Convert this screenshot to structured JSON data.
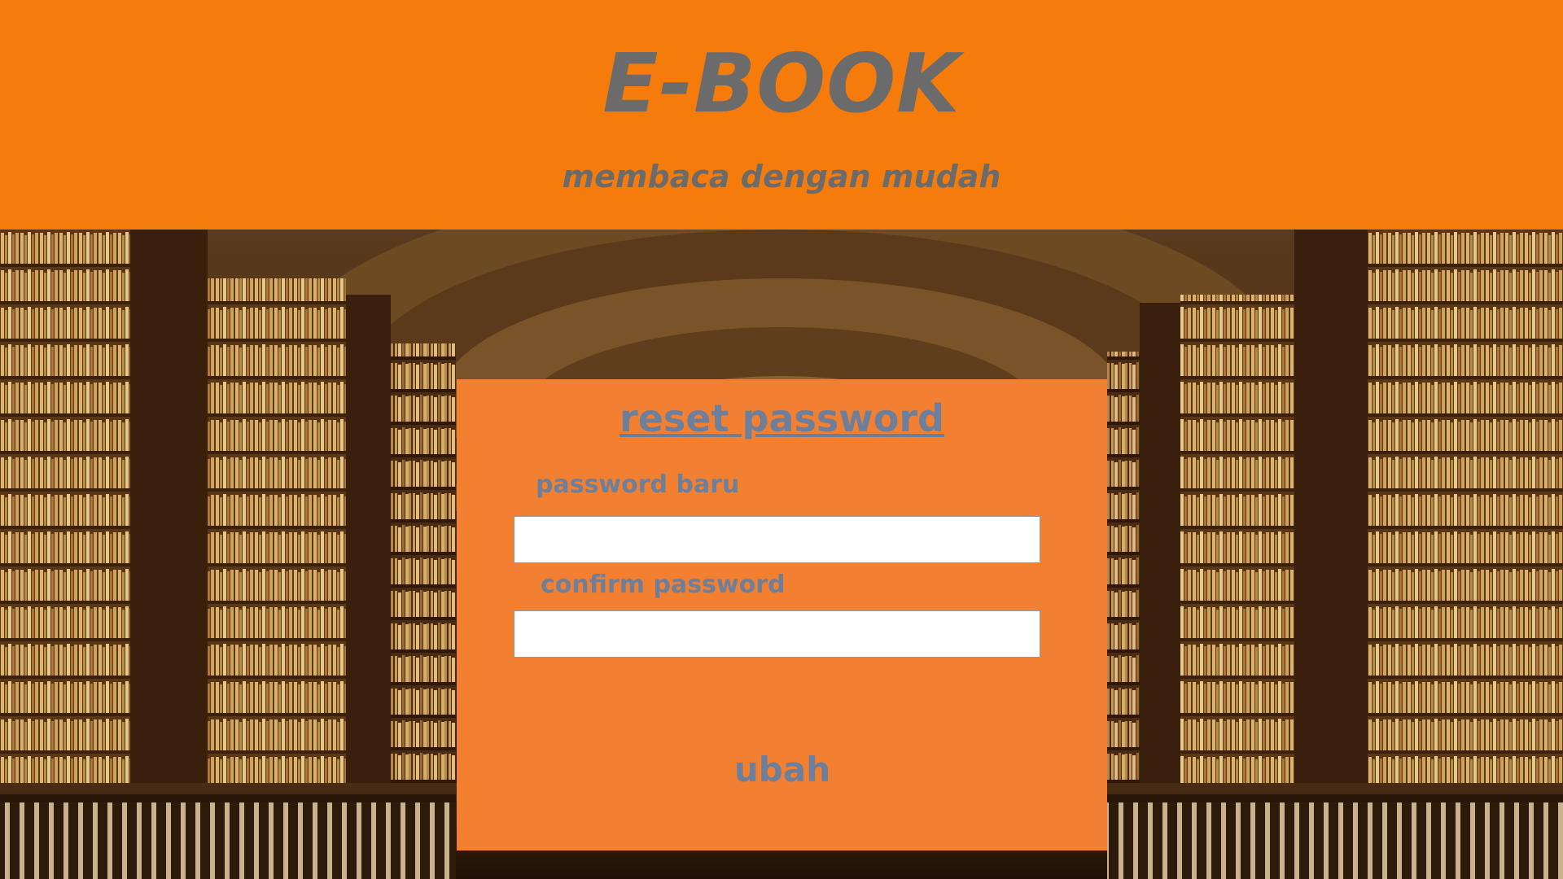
{
  "header": {
    "title": "E-BOOK",
    "tagline": "membaca dengan mudah",
    "background_color": "#f57c0b",
    "text_color": "#6b6b6b"
  },
  "background": {
    "scene": "library-bookshelves-image"
  },
  "form": {
    "title": "reset password",
    "new_password_label": "password baru",
    "new_password_value": "",
    "confirm_password_label": "confirm password",
    "confirm_password_value": "",
    "submit_label": "ubah",
    "panel_color": "#f28030",
    "text_color": "#6e7f9c"
  }
}
